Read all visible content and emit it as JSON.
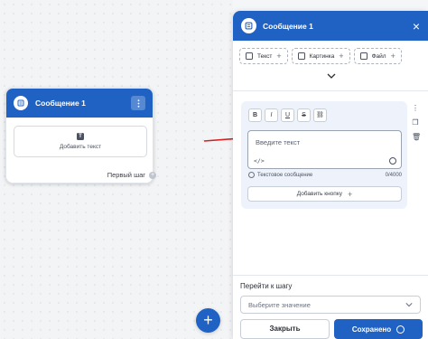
{
  "canvas": {
    "node": {
      "title": "Сообщение 1",
      "add_text": "Добавить текст",
      "first_step": "Первый шаг"
    },
    "fab_label": "+"
  },
  "panel": {
    "title": "Сообщение 1",
    "tags": [
      {
        "label": "Текст"
      },
      {
        "label": "Картинка"
      },
      {
        "label": "Файл"
      }
    ],
    "editor": {
      "format_buttons": [
        "B",
        "I",
        "U",
        "S",
        "⛓"
      ],
      "placeholder": "Введите текст",
      "text_message_label": "Текстовое сообщение",
      "char_count": "0/4000",
      "add_button_label": "Добавить кнопку"
    },
    "goto_label": "Перейти к шагу",
    "select_placeholder": "Выберите значение",
    "close_label": "Закрыть",
    "save_label": "Сохранено"
  },
  "colors": {
    "accent": "#1f62c4",
    "arrow": "#d62020"
  }
}
